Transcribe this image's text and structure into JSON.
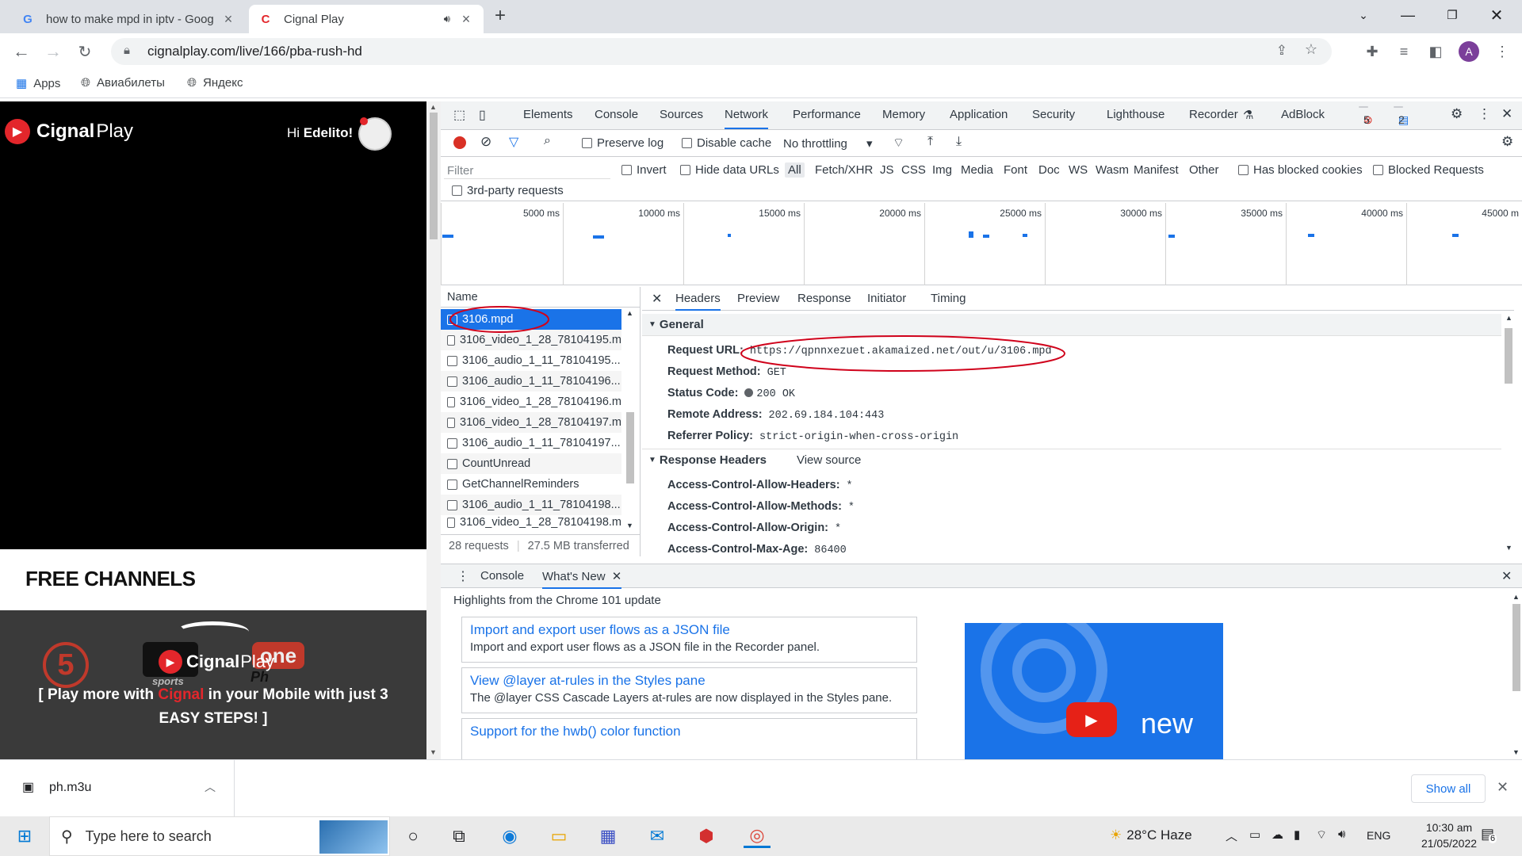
{
  "browser": {
    "tabs": [
      {
        "title": "how to make mpd in iptv - Goog",
        "active": false
      },
      {
        "title": "Cignal Play",
        "active": true
      }
    ],
    "url": "cignalplay.com/live/166/pba-rush-hd",
    "bookmarks": [
      "Apps",
      "Авиабилеты",
      "Яндекс"
    ],
    "profile_initial": "A"
  },
  "page": {
    "brand_main": "Cignal",
    "brand_sub": "Play",
    "greeting_prefix": "Hi ",
    "greeting_name": "Edelito",
    "greeting_suffix": "!",
    "section_title": "FREE CHANNELS",
    "promo_brand_main": "Cignal",
    "promo_brand_sub": "Play",
    "promo_line1_a": "[ Play more with ",
    "promo_line1_b": "Cignal",
    "promo_line1_c": " in your Mobile with just 3",
    "promo_line2": "EASY STEPS! ]",
    "logo_num": "5",
    "logo_one": "one",
    "logo_ph": "Ph",
    "logo_sports": "sports"
  },
  "devtools": {
    "tabs": [
      "Elements",
      "Console",
      "Sources",
      "Network",
      "Performance",
      "Memory",
      "Application",
      "Security",
      "Lighthouse",
      "Recorder",
      "AdBlock"
    ],
    "active_tab": "Network",
    "error_count": "5",
    "message_count": "2",
    "preserve_log": "Preserve log",
    "disable_cache": "Disable cache",
    "throttling": "No throttling",
    "filter_placeholder": "Filter",
    "invert": "Invert",
    "hide_data_urls": "Hide data URLs",
    "types": [
      "All",
      "Fetch/XHR",
      "JS",
      "CSS",
      "Img",
      "Media",
      "Font",
      "Doc",
      "WS",
      "Wasm",
      "Manifest",
      "Other"
    ],
    "has_blocked_cookies": "Has blocked cookies",
    "blocked_requests": "Blocked Requests",
    "third_party": "3rd-party requests",
    "timeline_ticks": [
      "5000 ms",
      "10000 ms",
      "15000 ms",
      "20000 ms",
      "25000 ms",
      "30000 ms",
      "35000 ms",
      "40000 ms",
      "45000 m"
    ],
    "name_header": "Name",
    "requests": [
      "3106.mpd",
      "3106_video_1_28_78104195.m",
      "3106_audio_1_11_78104195...",
      "3106_audio_1_11_78104196...",
      "3106_video_1_28_78104196.m",
      "3106_video_1_28_78104197.m",
      "3106_audio_1_11_78104197...",
      "CountUnread",
      "GetChannelReminders",
      "3106_audio_1_11_78104198...",
      "3106_video_1_28_78104198.m"
    ],
    "summary_requests": "28 requests",
    "summary_transferred": "27.5 MB transferred",
    "detail_tabs": [
      "Headers",
      "Preview",
      "Response",
      "Initiator",
      "Timing"
    ],
    "general_label": "General",
    "general": [
      {
        "k": "Request URL:",
        "v": "https://qpnnxezuet.akamaized.net/out/u/3106.mpd"
      },
      {
        "k": "Request Method:",
        "v": "GET"
      },
      {
        "k": "Status Code:",
        "v": "200 OK"
      },
      {
        "k": "Remote Address:",
        "v": "202.69.184.104:443"
      },
      {
        "k": "Referrer Policy:",
        "v": "strict-origin-when-cross-origin"
      }
    ],
    "response_headers_label": "Response Headers",
    "view_source": "View source",
    "response_headers": [
      {
        "k": "Access-Control-Allow-Headers:",
        "v": "*"
      },
      {
        "k": "Access-Control-Allow-Methods:",
        "v": "*"
      },
      {
        "k": "Access-Control-Allow-Origin:",
        "v": "*"
      },
      {
        "k": "Access-Control-Max-Age:",
        "v": "86400"
      }
    ],
    "drawer_tabs": [
      "Console",
      "What's New"
    ],
    "highlights": "Highlights from the Chrome 101 update",
    "cards": [
      {
        "title": "Import and export user flows as a JSON file",
        "desc": "Import and export user flows as a JSON file in the Recorder panel."
      },
      {
        "title": "View @layer at-rules in the Styles pane",
        "desc": "The @layer CSS Cascade Layers at-rules are now displayed in the Styles pane."
      },
      {
        "title": "Support for the hwb() color function",
        "desc": ""
      }
    ],
    "video_caption": "new"
  },
  "downloads": {
    "file": "ph.m3u",
    "show_all": "Show all"
  },
  "taskbar": {
    "search_placeholder": "Type here to search",
    "weather": "28°C  Haze",
    "lang": "ENG",
    "time": "10:30 am",
    "date": "21/05/2022",
    "notifications": "6"
  },
  "colors": {
    "accent": "#1a73e8",
    "cignal_red": "#e3262b",
    "annotation_red": "#d0021b"
  }
}
